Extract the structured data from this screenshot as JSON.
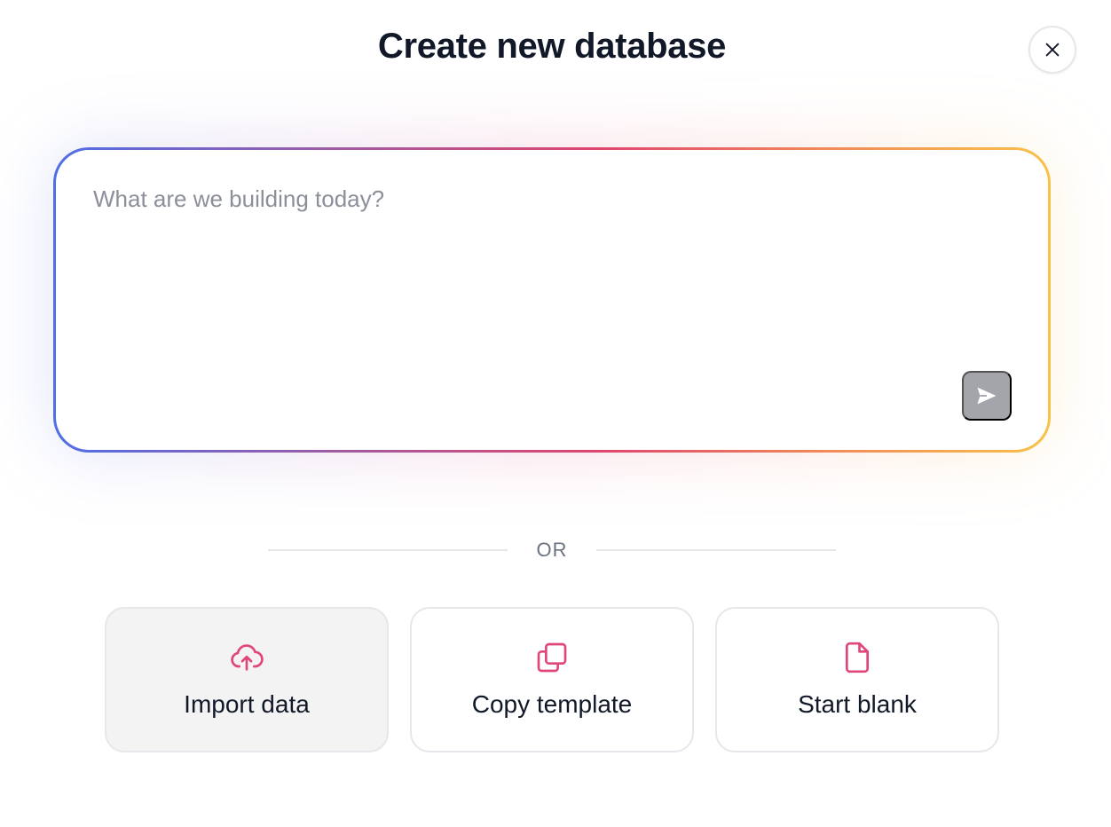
{
  "dialog": {
    "title": "Create new database",
    "close_label": "Close"
  },
  "prompt": {
    "placeholder": "What are we building today?",
    "value": "",
    "send_label": "Send"
  },
  "divider": {
    "text": "OR"
  },
  "options": [
    {
      "label": "Import data",
      "icon": "cloud-upload-icon",
      "selected": true
    },
    {
      "label": "Copy template",
      "icon": "copy-icon",
      "selected": false
    },
    {
      "label": "Start blank",
      "icon": "file-icon",
      "selected": false
    }
  ],
  "colors": {
    "accent": "#e0457b",
    "send_button": "#a3a5aa",
    "gradient_start": "#4f6fe6",
    "gradient_mid": "#e0466e",
    "gradient_end": "#f8c24a"
  }
}
